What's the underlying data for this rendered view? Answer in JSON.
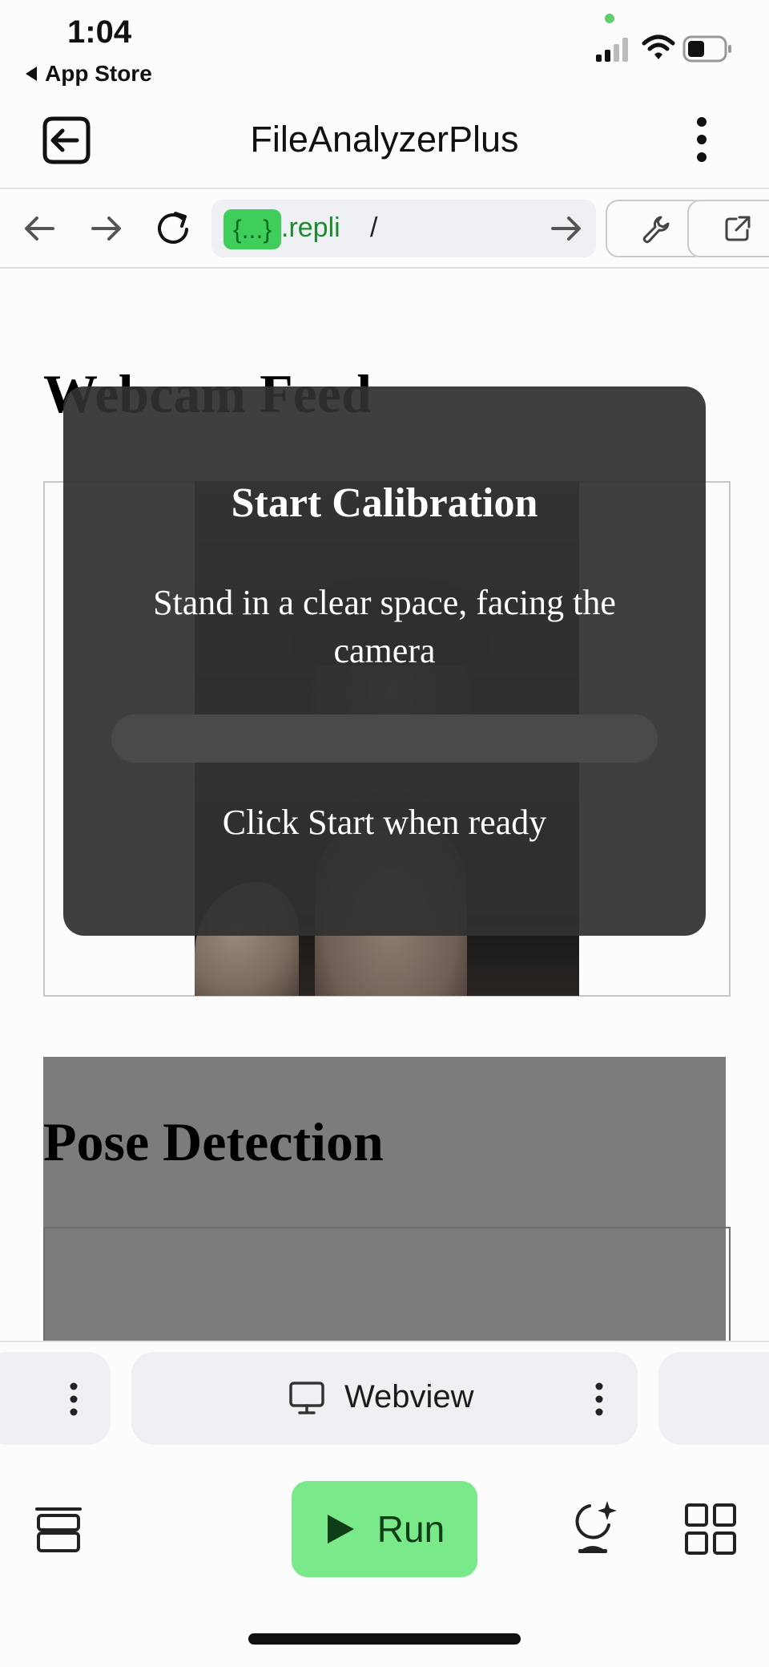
{
  "status_bar": {
    "time": "1:04",
    "back_label": "App Store"
  },
  "header": {
    "title": "FileAnalyzerPlus"
  },
  "url_bar": {
    "chip_label": "{...}",
    "domain": ".repli",
    "path": "/"
  },
  "webview": {
    "webcam_heading": "Webcam Feed",
    "pose_heading": "Pose Detection",
    "calibration": {
      "title": "Start Calibration",
      "instruction": "Stand in a clear space, facing the camera",
      "ready_text": "Click Start when ready"
    }
  },
  "tab_strip": {
    "active_tab_label": "Webview"
  },
  "toolbar": {
    "run_label": "Run"
  },
  "colors": {
    "accent_green": "#7ae98a",
    "url_green": "#1d8a2f",
    "chip_green": "#3fce59",
    "modal_bg": "#303030"
  }
}
